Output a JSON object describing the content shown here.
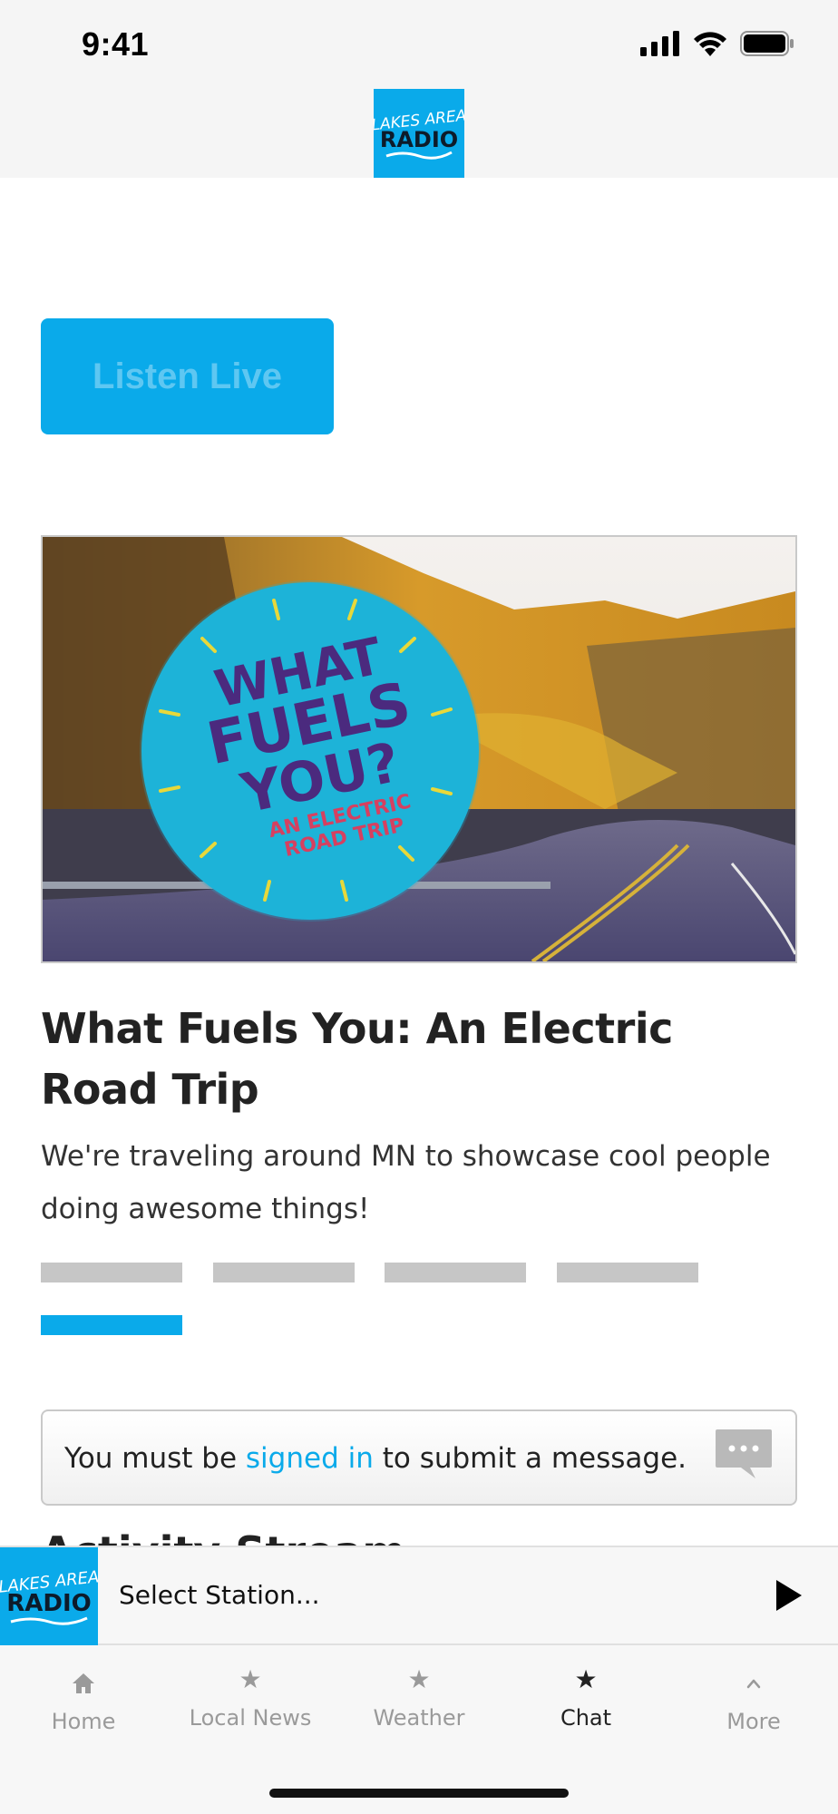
{
  "status_bar": {
    "time": "9:41"
  },
  "header": {
    "logo_top": "LAKES AREA",
    "logo_bottom": "RADIO"
  },
  "listen_button": {
    "label": "Listen Live"
  },
  "feature": {
    "badge_line1": "WHAT",
    "badge_line2": "FUELS",
    "badge_line3": "YOU?",
    "badge_sub1": "AN ELECTRIC",
    "badge_sub2": "ROAD TRIP",
    "title": "What Fuels You: An Electric Road Trip",
    "description": "We're traveling around MN to showcase cool people doing awesome things!"
  },
  "carousel": {
    "slides": 5,
    "active_index": 4
  },
  "message": {
    "prefix": "You must be ",
    "link": "signed in",
    "suffix": " to submit a message."
  },
  "section": {
    "cutoff_heading": "Activity Stream"
  },
  "player": {
    "logo_top": "LAKES AREA",
    "logo_bottom": "RADIO",
    "station": "Select Station..."
  },
  "tabs": [
    {
      "label": "Home",
      "icon": "home-icon"
    },
    {
      "label": "Local News",
      "icon": "star-icon"
    },
    {
      "label": "Weather",
      "icon": "star-icon"
    },
    {
      "label": "Chat",
      "icon": "star-icon",
      "active": true
    },
    {
      "label": "More",
      "icon": "chevron-up-icon"
    }
  ],
  "colors": {
    "accent": "#0aaaea",
    "badge": "#1db3d8",
    "title_purple": "#4b2a7e",
    "sub_red": "#d64060"
  }
}
